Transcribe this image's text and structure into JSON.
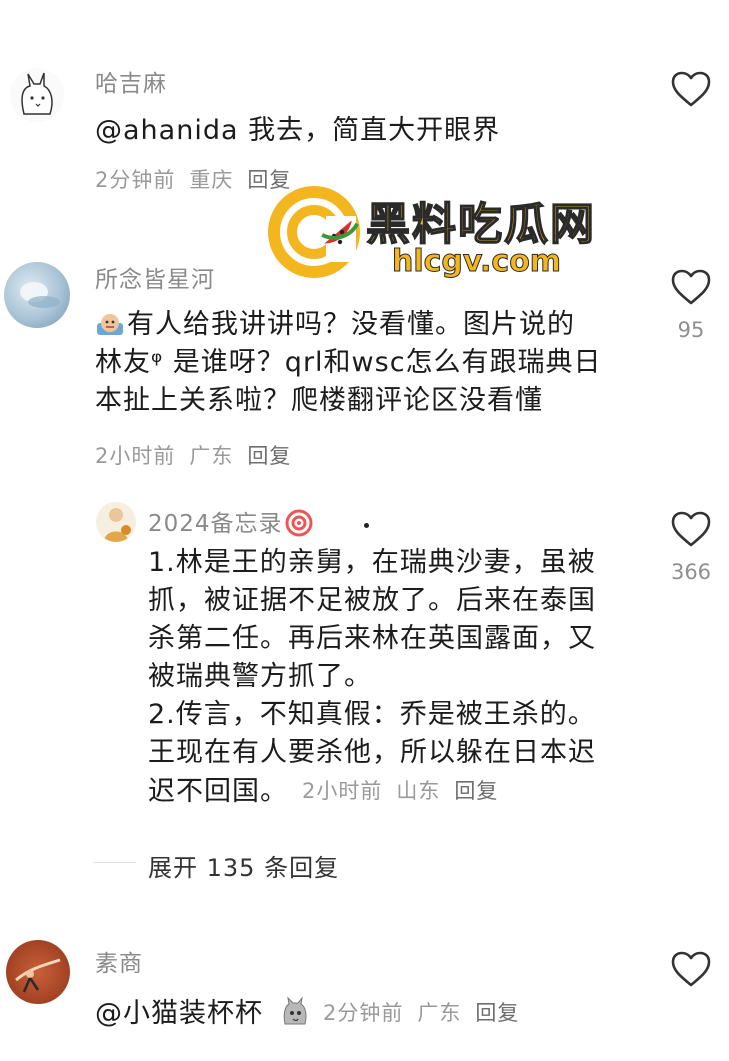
{
  "comments": [
    {
      "user": "哈吉麻",
      "text": "@ahanida 我去，简直大开眼界",
      "time": "2分钟前",
      "location": "重庆",
      "reply_label": "回复",
      "like_count": ""
    },
    {
      "user": "所念皆星河",
      "text_lines": [
        "有人给我讲讲吗？没看懂。图片说的",
        "林友ᵠ 是谁呀？qrl和wsc怎么有跟瑞典日",
        "本扯上关系啦？爬楼翻评论区没看懂"
      ],
      "time": "2小时前",
      "location": "广东",
      "reply_label": "回复",
      "like_count": "95"
    },
    {
      "user": "2024备忘录",
      "text_lines": [
        "1.林是王的亲舅，在瑞典沙妻，虽被",
        "抓，被证据不足被放了。后来在泰国",
        "杀第二任。再后来林在英国露面，又",
        "被瑞典警方抓了。",
        "2.传言，不知真假：乔是被王杀的。",
        "王现在有人要杀他，所以躲在日本迟",
        "迟不回国。"
      ],
      "time": "2小时前",
      "location": "山东",
      "reply_label": "回复",
      "like_count": "366"
    },
    {
      "user": "素商",
      "text": "@小猫装杯杯",
      "time": "2分钟前",
      "location": "广东",
      "reply_label": "回复",
      "like_count": ""
    }
  ],
  "expand_replies": "展开 135 条回复",
  "watermark": {
    "title": "黑料吃瓜网",
    "url": "hlcgv.com"
  },
  "colors": {
    "username": "#8a8a8a",
    "meta": "#9a9a9a",
    "watermark_yellow": "#f3b61f",
    "watermark_red": "#d8312b"
  }
}
